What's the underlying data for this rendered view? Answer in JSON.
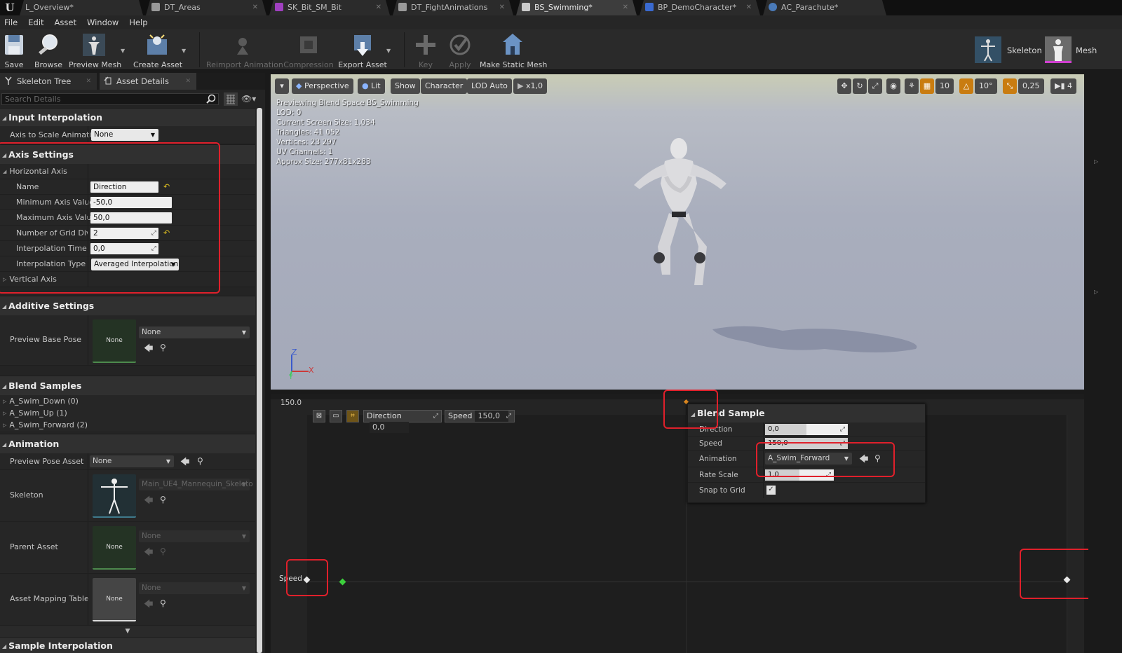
{
  "tabs": [
    {
      "label": "L_Overview*",
      "color": "#2b2b2b",
      "active": false
    },
    {
      "label": "DT_Areas",
      "color": "#8a8a8a"
    },
    {
      "label": "SK_Bit_SM_Bit",
      "color": "#a040c0"
    },
    {
      "label": "DT_FightAnimations",
      "color": "#8a8a8a"
    },
    {
      "label": "BS_Swimming*",
      "color": "#cccccc"
    },
    {
      "label": "BP_DemoCharacter*",
      "color": "#3a6ad0"
    },
    {
      "label": "AC_Parachute*",
      "color": "#4a7ab8"
    }
  ],
  "menu": [
    "File",
    "Edit",
    "Asset",
    "Window",
    "Help"
  ],
  "toolbar": {
    "save": "Save",
    "browse": "Browse",
    "preview_mesh": "Preview Mesh",
    "create_asset": "Create Asset",
    "reimport": "Reimport Animation",
    "compression": "Compression",
    "export_asset": "Export Asset",
    "key": "Key",
    "apply": "Apply",
    "make_static_mesh": "Make Static Mesh",
    "skeleton": "Skeleton",
    "mesh": "Mesh"
  },
  "panel_tabs": {
    "skeleton_tree": "Skeleton Tree",
    "asset_details": "Asset Details"
  },
  "search": {
    "placeholder": "Search Details"
  },
  "details": {
    "input_interpolation": {
      "title": "Input Interpolation",
      "axis_to_scale_label": "Axis to Scale Animation",
      "axis_to_scale_value": "None"
    },
    "axis_settings": {
      "title": "Axis Settings",
      "horizontal_axis": "Horizontal Axis",
      "name_label": "Name",
      "name_value": "Direction",
      "min_label": "Minimum Axis Value",
      "min_value": "-50,0",
      "max_label": "Maximum Axis Value",
      "max_value": "50,0",
      "grid_label": "Number of Grid Divisic",
      "grid_value": "2",
      "interp_time_label": "Interpolation Time",
      "interp_time_value": "0,0",
      "interp_type_label": "Interpolation Type",
      "interp_type_value": "Averaged Interpolation",
      "vertical_axis": "Vertical Axis"
    },
    "additive_settings": {
      "title": "Additive Settings",
      "preview_base_pose_label": "Preview Base Pose",
      "thumb_none": "None",
      "combo_value": "None"
    },
    "blend_samples": {
      "title": "Blend Samples",
      "items": [
        "A_Swim_Down (0)",
        "A_Swim_Up (1)",
        "A_Swim_Forward (2)"
      ]
    },
    "animation": {
      "title": "Animation",
      "preview_pose_label": "Preview Pose Asset",
      "preview_pose_value": "None",
      "skeleton_label": "Skeleton",
      "skeleton_value": "Main_UE4_Mannequin_Skeleto",
      "parent_label": "Parent Asset",
      "parent_thumb": "None",
      "parent_value": "None",
      "mapping_label": "Asset Mapping Table",
      "mapping_thumb": "None",
      "mapping_value": "None"
    },
    "sample_interpolation": {
      "title": "Sample Interpolation"
    }
  },
  "viewport": {
    "perspective": "Perspective",
    "lit": "Lit",
    "show": "Show",
    "character": "Character",
    "lod": "LOD Auto",
    "speed": "x1,0",
    "grid_snap": "10",
    "rot_snap": "10°",
    "scale_snap": "0,25",
    "cam_speed": "4",
    "stats": [
      "Previewing Blend Space BS_Swimming",
      "LOD: 0",
      "Current Screen Size: 1,034",
      "Triangles: 41 052",
      "Vertices: 23 297",
      "UV Channels: 1",
      "Approx Size: 277x81x283"
    ],
    "axis_z": "Z",
    "axis_x": "X",
    "axis_y": "Y"
  },
  "blendspace": {
    "top_value": "150.0",
    "direction_label": "Direction",
    "direction_value": "0,0",
    "speed_label": "Speed",
    "speed_value": "150,0",
    "axis_label": "Speed"
  },
  "blend_sample_popup": {
    "title": "Blend Sample",
    "direction_label": "Direction",
    "direction_value": "0,0",
    "speed_label": "Speed",
    "speed_value": "150,0",
    "animation_label": "Animation",
    "animation_value": "A_Swim_Forward",
    "rate_label": "Rate Scale",
    "rate_value": "1,0",
    "snap_label": "Snap to Grid",
    "snap_checked": true
  },
  "colors": {
    "highlight": "#e0202b",
    "accent": "#c97c10",
    "sample_green": "#3cd03c"
  }
}
